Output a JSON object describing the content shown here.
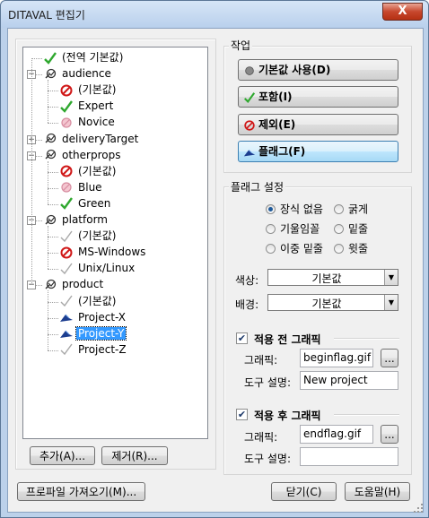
{
  "window": {
    "title": "DITAVAL 편집기",
    "close_glyph": "X"
  },
  "tree": {
    "rows": [
      {
        "label": "(전역 기본값)",
        "icon": "check-icon"
      },
      {
        "label": "audience",
        "icon": "group-icon"
      },
      {
        "label": "(기본값)",
        "icon": "exclude-icon"
      },
      {
        "label": "Expert",
        "icon": "check-icon"
      },
      {
        "label": "Novice",
        "icon": "exclude-faded-icon"
      },
      {
        "label": "deliveryTarget",
        "icon": "group-icon"
      },
      {
        "label": "otherprops",
        "icon": "group-icon"
      },
      {
        "label": "(기본값)",
        "icon": "exclude-icon"
      },
      {
        "label": "Blue",
        "icon": "exclude-faded-icon"
      },
      {
        "label": "Green",
        "icon": "check-icon"
      },
      {
        "label": "platform",
        "icon": "group-icon"
      },
      {
        "label": "(기본값)",
        "icon": "check-faded-icon"
      },
      {
        "label": "MS-Windows",
        "icon": "exclude-icon"
      },
      {
        "label": "Unix/Linux",
        "icon": "check-faded-icon"
      },
      {
        "label": "product",
        "icon": "group-icon"
      },
      {
        "label": "(기본값)",
        "icon": "check-faded-icon"
      },
      {
        "label": "Project-X",
        "icon": "flag-icon"
      },
      {
        "label": "Project-Y",
        "icon": "flag-icon"
      },
      {
        "label": "Project-Z",
        "icon": "check-faded-icon"
      }
    ],
    "selected_label": "Project-Y",
    "add_button": "추가(A)...",
    "remove_button": "제거(R)..."
  },
  "actions": {
    "group_label": "작업",
    "buttons": [
      {
        "label": "기본값 사용(D)",
        "icon": "default-dot-icon"
      },
      {
        "label": "포함(I)",
        "icon": "check-icon"
      },
      {
        "label": "제외(E)",
        "icon": "exclude-icon"
      },
      {
        "label": "플래그(F)",
        "icon": "flag-icon"
      }
    ],
    "active_index": 3
  },
  "flag_settings": {
    "group_label": "플래그 설정",
    "style_options": [
      "장식 없음",
      "굵게",
      "기울임꼴",
      "밑줄",
      "이중 밑줄",
      "윗줄"
    ],
    "selected_style": "장식 없음",
    "color_label": "색상:",
    "color_value": "기본값",
    "background_label": "배경:",
    "background_value": "기본값",
    "before": {
      "checkbox_label": "적용 전 그래픽",
      "checked": true,
      "graphic_label": "그래픽:",
      "graphic_value": "beginflag.gif",
      "browse_label": "...",
      "tooltip_label": "도구 설명:",
      "tooltip_value": "New project"
    },
    "after": {
      "checkbox_label": "적용 후 그래픽",
      "checked": true,
      "graphic_label": "그래픽:",
      "graphic_value": "endflag.gif",
      "browse_label": "...",
      "tooltip_label": "도구 설명:",
      "tooltip_value": ""
    }
  },
  "footer": {
    "import_button": "프로파일 가져오기(M)...",
    "close_button": "닫기(C)",
    "help_button": "도움말(H)"
  },
  "colors": {
    "check": "#2fa82f",
    "exclude": "#d01818",
    "flag": "#1c3d8f",
    "selection": "#3399ff"
  }
}
